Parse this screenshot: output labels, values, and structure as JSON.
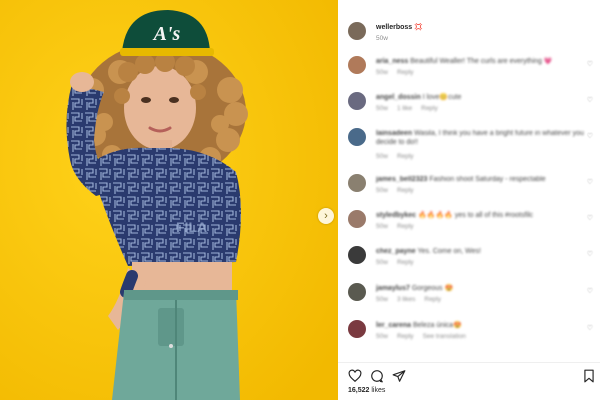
{
  "post": {
    "author": "wellerboss",
    "author_suffix": "💢",
    "author_time": "50w",
    "photo_cap_text": "A's",
    "photo_shirt_text": "FILA"
  },
  "comments": [
    {
      "user": "aria_ness",
      "text": "Beautiful Wealler! The curls are everything 💗",
      "time": "50w",
      "likes": "",
      "reply": "Reply",
      "extra": ""
    },
    {
      "user": "angel_dossin",
      "text": "I love😊cute",
      "time": "50w",
      "likes": "1 like",
      "reply": "Reply",
      "extra": ""
    },
    {
      "user": "lainsadeen",
      "text": "Wasila, I think you have a bright future in whatever you decide to do!!",
      "time": "50w",
      "likes": "",
      "reply": "Reply",
      "extra": ""
    },
    {
      "user": "james_bell2323",
      "text": "Fashion shoot Saturday - respectable",
      "time": "50w",
      "likes": "",
      "reply": "Reply",
      "extra": ""
    },
    {
      "user": "styledbykec",
      "text": "🔥🔥🔥🔥 yes to all of this #rootsfilc",
      "time": "50w",
      "likes": "",
      "reply": "Reply",
      "extra": ""
    },
    {
      "user": "chez_payne",
      "text": "Yes. Come on, Wes!",
      "time": "50w",
      "likes": "",
      "reply": "Reply",
      "extra": ""
    },
    {
      "user": "jamaylus7",
      "text": "Gorgeous 😍",
      "time": "50w",
      "likes": "3 likes",
      "reply": "Reply",
      "extra": ""
    },
    {
      "user": "ler_carena",
      "text": "Beleza única😍",
      "time": "50w",
      "likes": "",
      "reply": "Reply",
      "extra": "See translation"
    }
  ],
  "actions": {
    "heart_icon": "heart-icon",
    "comment_icon": "comment-icon",
    "share_icon": "share-icon",
    "bookmark_icon": "bookmark-icon"
  },
  "likes": {
    "count": "16,522",
    "label": "likes"
  },
  "colors": {
    "background_yellow": "#f7c600",
    "shirt_navy": "#2a3a6e",
    "pants_green": "#6fa89a",
    "cap_green": "#0e4d3a"
  }
}
